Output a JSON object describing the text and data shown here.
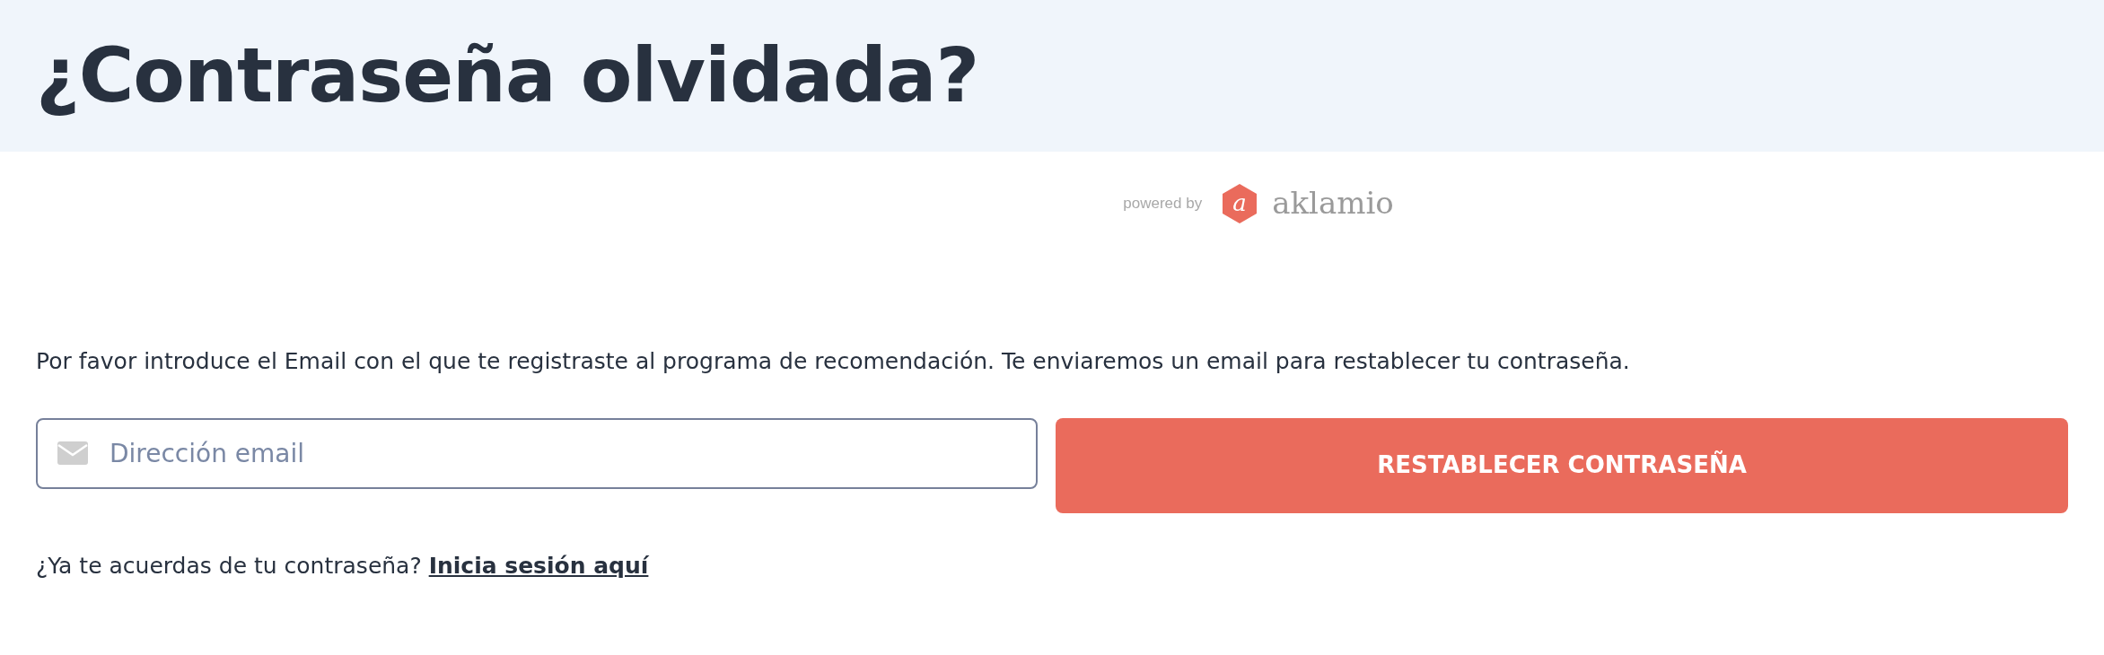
{
  "header": {
    "title": "¿Contraseña olvidada?"
  },
  "powered_by": {
    "label": "powered by",
    "logo_letter": "a",
    "brand": "aklamio"
  },
  "intro": "Por favor introduce el Email con el que te registraste al programa de recomendación. Te enviaremos un email para restablecer tu contraseña.",
  "email_field": {
    "placeholder": "Dirección email"
  },
  "submit_button": "RESTABLECER CONTRASEÑA",
  "login_prompt": {
    "text": "¿Ya te acuerdas de tu contraseña?",
    "link": "Inicia sesión aquí"
  }
}
